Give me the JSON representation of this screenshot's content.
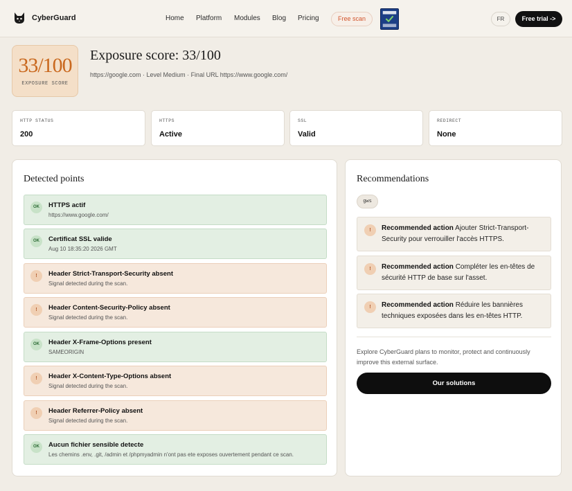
{
  "nav": {
    "brand": "CyberGuard",
    "links": [
      "Home",
      "Platform",
      "Modules",
      "Blog",
      "Pricing"
    ],
    "free_scan": "Free scan",
    "cert_badge_text": "CYBER ESSENTIALS CERTIFIED PLUS",
    "lang": "FR",
    "free_trial": "Free trial ->"
  },
  "score": {
    "value": "33/100",
    "caption": "EXPOSURE SCORE",
    "title": "Exposure score: 33/100",
    "subtitle": "https://google.com · Level Medium · Final URL https://www.google.com/"
  },
  "stats": [
    {
      "label": "HTTP STATUS",
      "value": "200"
    },
    {
      "label": "HTTPS",
      "value": "Active"
    },
    {
      "label": "SSL",
      "value": "Valid"
    },
    {
      "label": "REDIRECT",
      "value": "None"
    }
  ],
  "detected": {
    "title": "Detected points",
    "items": [
      {
        "status": "ok",
        "badge": "OK",
        "title": "HTTPS actif",
        "sub": "https://www.google.com/"
      },
      {
        "status": "ok",
        "badge": "OK",
        "title": "Certificat SSL valide",
        "sub": "Aug 10 18:35:20 2026 GMT"
      },
      {
        "status": "warn",
        "badge": "!",
        "title": "Header Strict-Transport-Security absent",
        "sub": "Signal detected during the scan."
      },
      {
        "status": "warn",
        "badge": "!",
        "title": "Header Content-Security-Policy absent",
        "sub": "Signal detected during the scan."
      },
      {
        "status": "ok",
        "badge": "OK",
        "title": "Header X-Frame-Options present",
        "sub": "SAMEORIGIN"
      },
      {
        "status": "warn",
        "badge": "!",
        "title": "Header X-Content-Type-Options absent",
        "sub": "Signal detected during the scan."
      },
      {
        "status": "warn",
        "badge": "!",
        "title": "Header Referrer-Policy absent",
        "sub": "Signal detected during the scan."
      },
      {
        "status": "ok",
        "badge": "OK",
        "title": "Aucun fichier sensible detecte",
        "sub": "Les chemins .env, .git, /admin et /phpmyadmin n'ont pas ete exposes ouvertement pendant ce scan."
      }
    ]
  },
  "recommendations": {
    "title": "Recommendations",
    "tag": "gws",
    "items": [
      {
        "badge": "!",
        "lead": "Recommended action",
        "text": "Ajouter Strict-Transport-Security pour verrouiller l'accès HTTPS."
      },
      {
        "badge": "!",
        "lead": "Recommended action",
        "text": "Compléter les en-têtes de sécurité HTTP de base sur l'asset."
      },
      {
        "badge": "!",
        "lead": "Recommended action",
        "text": "Réduire les bannières techniques exposées dans les en-têtes HTTP."
      }
    ],
    "explore": "Explore CyberGuard plans to monitor, protect and continuously improve this external surface.",
    "cta": "Our solutions"
  },
  "colors": {
    "accent_orange": "#c9681e",
    "ok_bg": "#e3efe3",
    "warn_bg": "#f6e8dc",
    "brand_dark": "#111111"
  }
}
